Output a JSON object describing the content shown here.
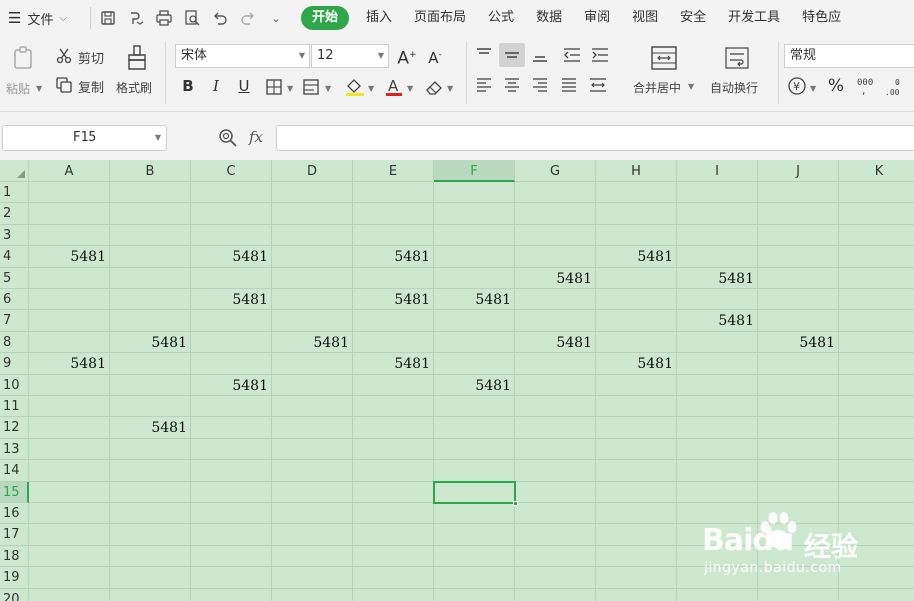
{
  "menubar": {
    "file_label": "文件",
    "tabs": [
      "开始",
      "插入",
      "页面布局",
      "公式",
      "数据",
      "审阅",
      "视图",
      "安全",
      "开发工具",
      "特色应"
    ]
  },
  "ribbon": {
    "paste_label": "粘贴",
    "cut_label": "剪切",
    "copy_label": "复制",
    "format_painter_label": "格式刷",
    "font_name": "宋体",
    "font_size": "12",
    "bold": "B",
    "italic": "I",
    "underline": "U",
    "merge_center_label": "合并居中",
    "wrap_text_label": "自动换行",
    "number_format": "常规",
    "percent": "%"
  },
  "formula_bar": {
    "name_box": "F15",
    "fx_label": "fx",
    "formula_value": ""
  },
  "sheet": {
    "columns": [
      "A",
      "B",
      "C",
      "D",
      "E",
      "F",
      "G",
      "H",
      "I",
      "J",
      "K"
    ],
    "rows": [
      "1",
      "2",
      "3",
      "4",
      "5",
      "6",
      "7",
      "8",
      "9",
      "10",
      "11",
      "12",
      "13",
      "14",
      "15",
      "16",
      "17",
      "18",
      "19",
      "20"
    ],
    "selected_column": "F",
    "selected_row": "15",
    "active_cell": "F15",
    "cells": [
      {
        "ref": "A4",
        "value": "5481"
      },
      {
        "ref": "C4",
        "value": "5481"
      },
      {
        "ref": "E4",
        "value": "5481"
      },
      {
        "ref": "H4",
        "value": "5481"
      },
      {
        "ref": "G5",
        "value": "5481"
      },
      {
        "ref": "I5",
        "value": "5481"
      },
      {
        "ref": "C6",
        "value": "5481"
      },
      {
        "ref": "E6",
        "value": "5481"
      },
      {
        "ref": "F6",
        "value": "5481"
      },
      {
        "ref": "I7",
        "value": "5481"
      },
      {
        "ref": "B8",
        "value": "5481"
      },
      {
        "ref": "D8",
        "value": "5481"
      },
      {
        "ref": "G8",
        "value": "5481"
      },
      {
        "ref": "J8",
        "value": "5481"
      },
      {
        "ref": "A9",
        "value": "5481"
      },
      {
        "ref": "E9",
        "value": "5481"
      },
      {
        "ref": "H9",
        "value": "5481"
      },
      {
        "ref": "C10",
        "value": "5481"
      },
      {
        "ref": "F10",
        "value": "5481"
      },
      {
        "ref": "B12",
        "value": "5481"
      }
    ],
    "background_color": "#cce8cf",
    "accent_color": "#2ea64a"
  },
  "watermark": {
    "brand": "Baidu",
    "brand_cn": "经验",
    "url": "jingyan.baidu.com"
  }
}
